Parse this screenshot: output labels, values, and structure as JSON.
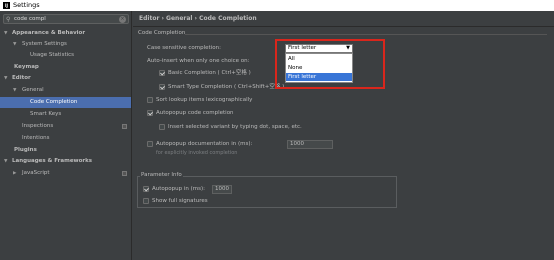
{
  "window": {
    "app_icon": "IJ",
    "title": "Settings"
  },
  "search": {
    "value": "code compl",
    "icon": "search-icon"
  },
  "tree": [
    {
      "label": "Appearance & Behavior",
      "expanded": true
    },
    {
      "label": "System Settings",
      "expanded": true
    },
    {
      "label": "Usage Statistics"
    },
    {
      "label": "Keymap"
    },
    {
      "label": "Editor",
      "expanded": true
    },
    {
      "label": "General",
      "expanded": true
    },
    {
      "label": "Code Completion",
      "selected": true
    },
    {
      "label": "Smart Keys"
    },
    {
      "label": "Inspections"
    },
    {
      "label": "Intentions"
    },
    {
      "label": "Plugins"
    },
    {
      "label": "Languages & Frameworks",
      "expanded": true
    },
    {
      "label": "JavaScript"
    }
  ],
  "breadcrumb": "Editor › General › Code Completion",
  "code_completion": {
    "group_title": "Code Completion",
    "case_sensitive_label": "Case sensitive completion:",
    "case_sensitive_value": "First letter",
    "case_sensitive_options": [
      "All",
      "None",
      "First letter"
    ],
    "auto_insert_label": "Auto-insert when only one choice on:",
    "basic_completion": {
      "label": "Basic Completion ( Ctrl+空格 )",
      "checked": true
    },
    "smart_type_completion": {
      "label": "Smart Type Completion ( Ctrl+Shift+空格 )",
      "checked": true
    },
    "sort_lookup": {
      "label": "Sort lookup items lexicographically",
      "checked": false
    },
    "autopopup_code": {
      "label": "Autopopup code completion",
      "checked": true
    },
    "insert_selected": {
      "label": "Insert selected variant by typing dot, space, etc.",
      "checked": false
    },
    "autopopup_doc": {
      "label": "Autopopup documentation in (ms):",
      "checked": false,
      "value": "1000"
    },
    "autopopup_doc_hint": "for explicitly invoked completion"
  },
  "parameter_info": {
    "group_title": "Parameter Info",
    "autopopup": {
      "label": "Autopopup in (ms):",
      "checked": true,
      "value": "1000"
    },
    "show_full_signatures": {
      "label": "Show full signatures",
      "checked": false
    }
  },
  "colors": {
    "selection": "#4b6eaf",
    "dropdown_highlight": "#3875d7",
    "annotation_box": "#d9261c"
  }
}
